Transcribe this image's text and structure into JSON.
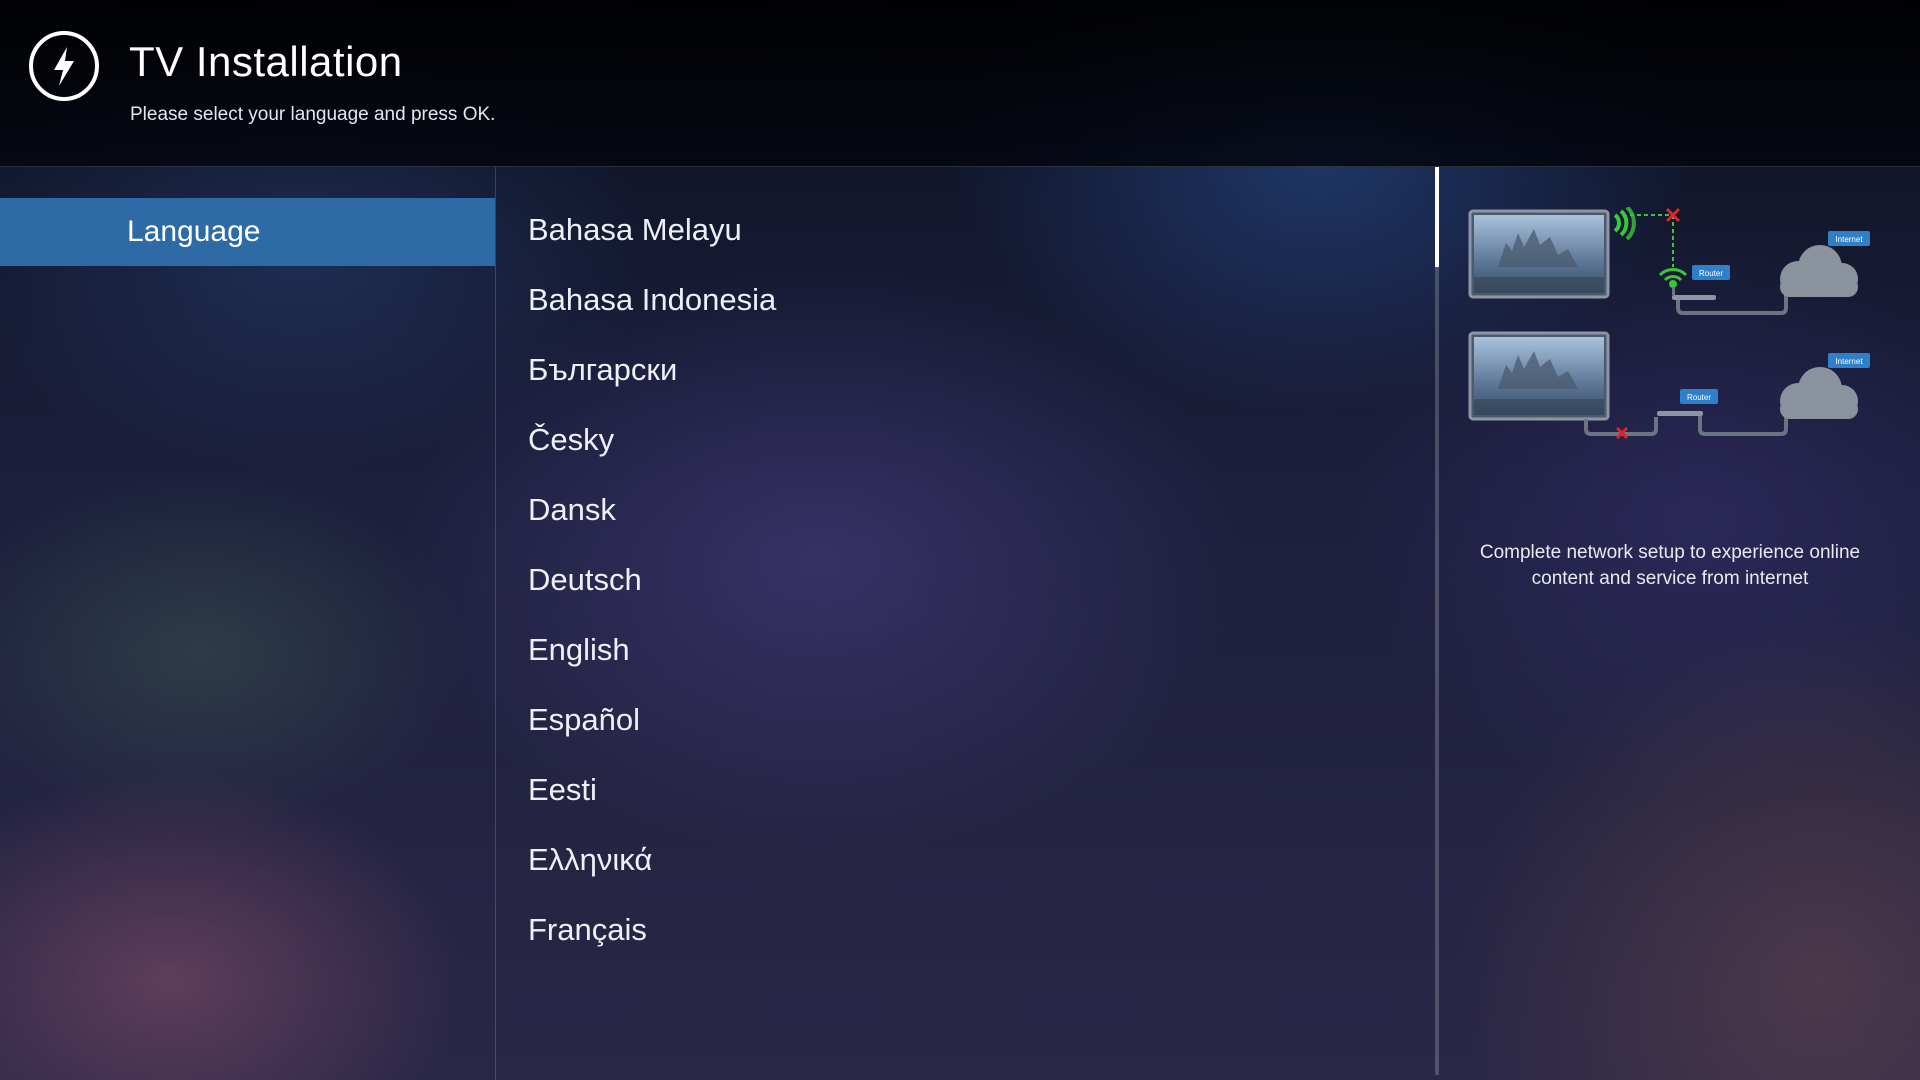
{
  "header": {
    "title": "TV Installation",
    "subtitle": "Please select your language and press OK.",
    "icon": "lightning-bolt-icon"
  },
  "sidebar": {
    "items": [
      {
        "label": "Language",
        "selected": true
      }
    ]
  },
  "languages": [
    "Bahasa Melayu",
    "Bahasa Indonesia",
    "Български",
    "Česky",
    "Dansk",
    "Deutsch",
    "English",
    "Español",
    "Eesti",
    "Ελληνικά",
    "Français"
  ],
  "info": {
    "illustration": {
      "router_label": "Router",
      "internet_label": "Internet"
    },
    "text": "Complete network setup to experience online content and service from internet"
  },
  "colors": {
    "selection": "#2d6aa6",
    "wifi": "#3cc43c",
    "error": "#e0252a",
    "tag": "#2f80c8"
  }
}
